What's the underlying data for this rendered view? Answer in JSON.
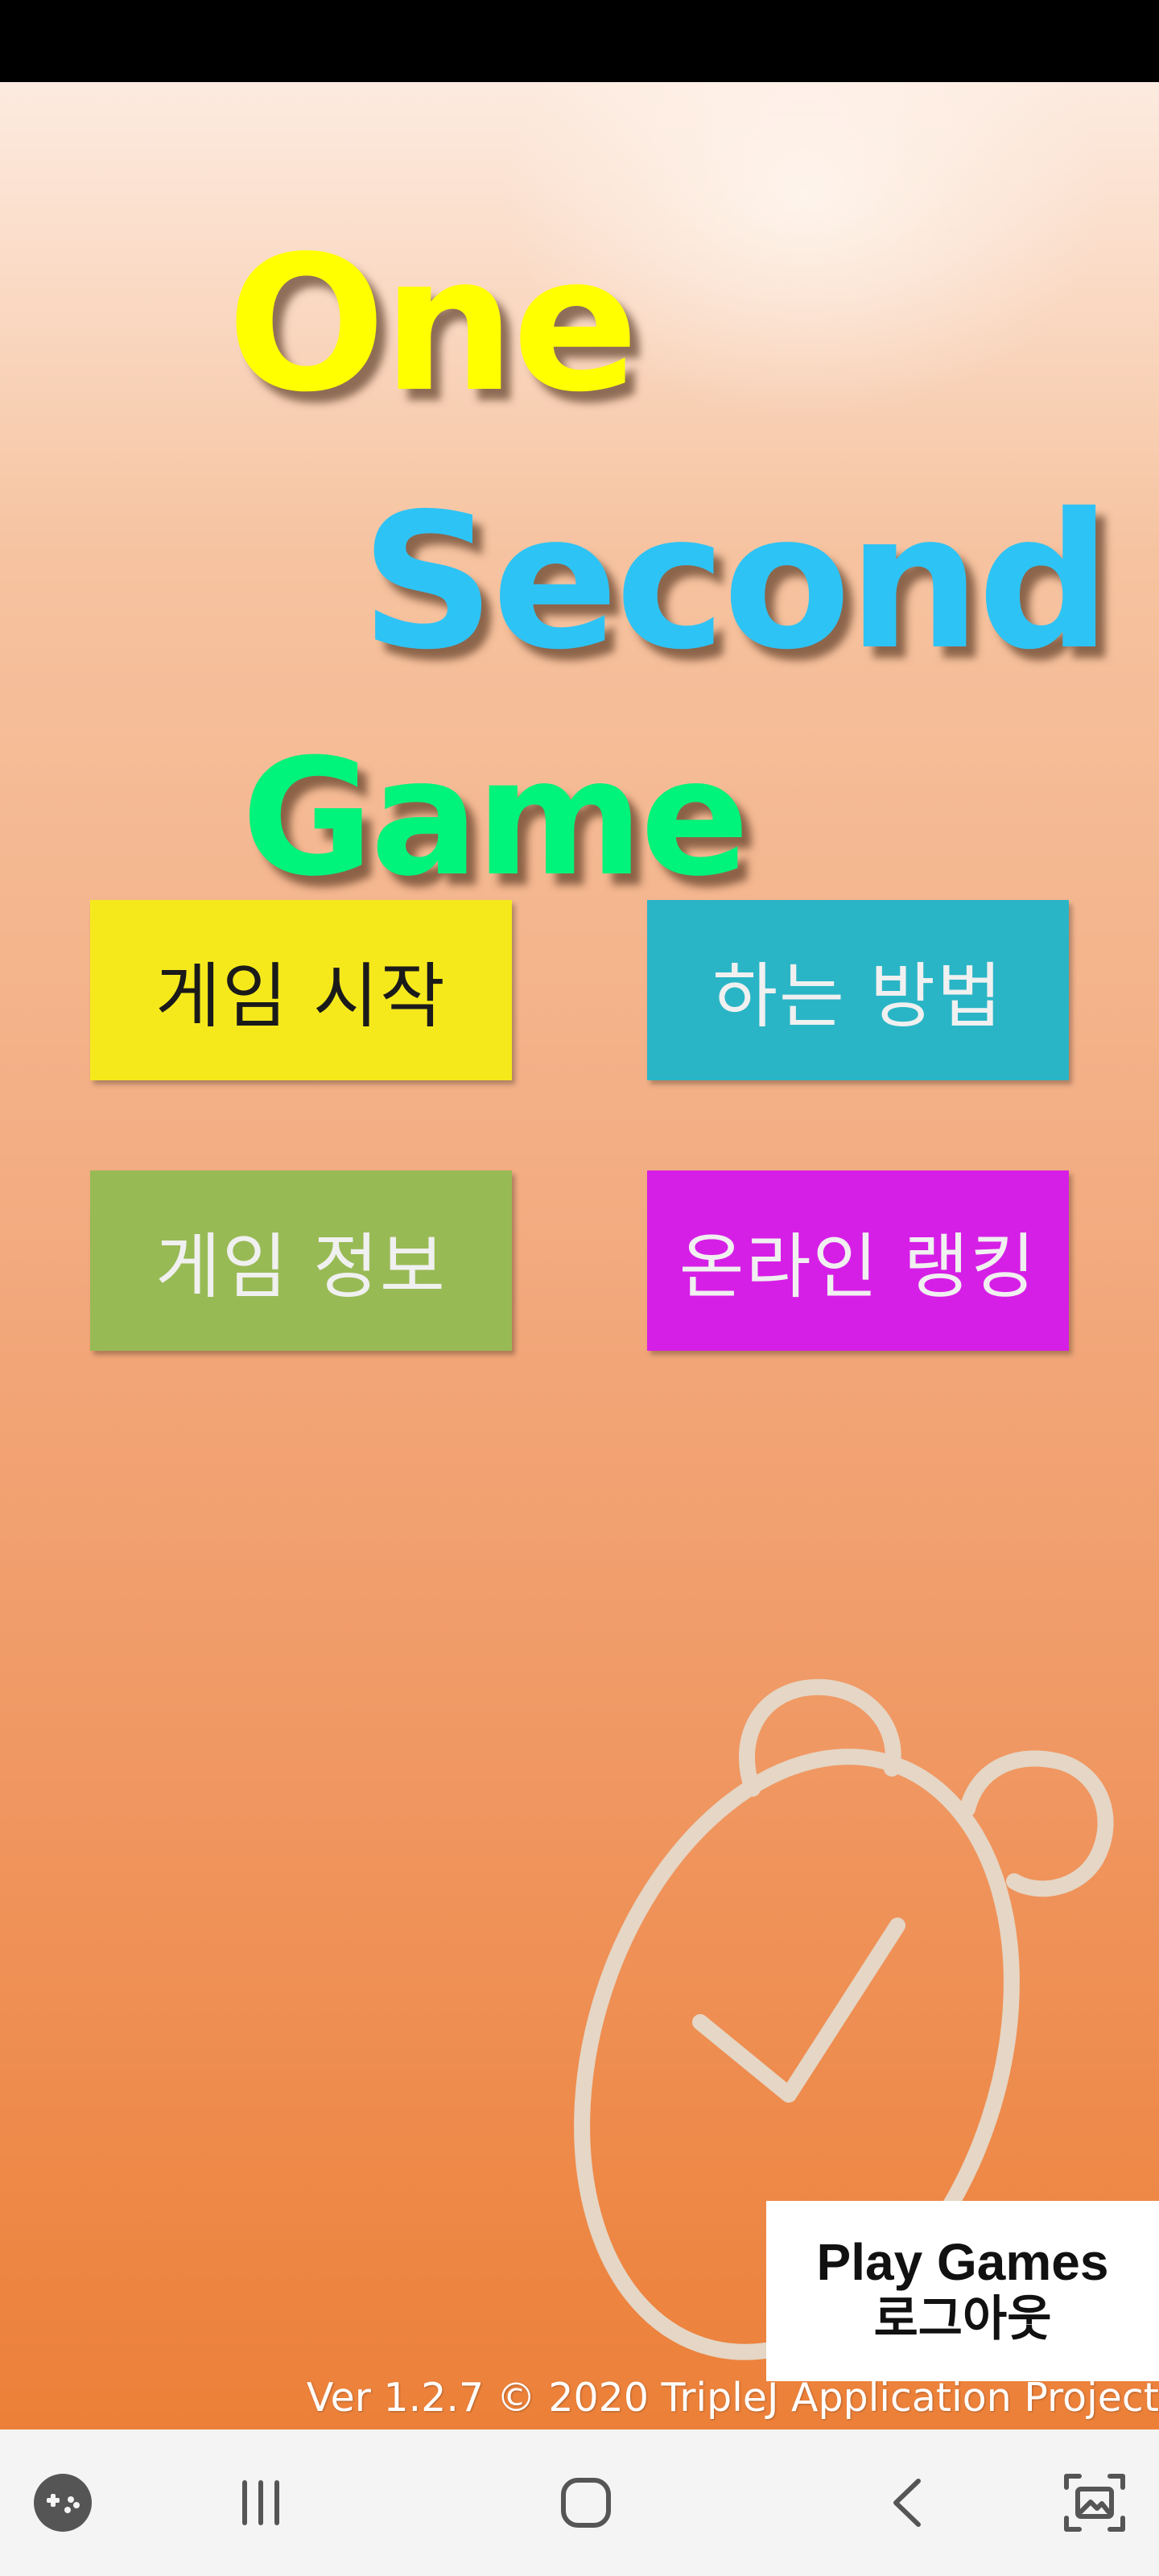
{
  "title": {
    "line1": "One",
    "line2": "Second",
    "line3": "Game"
  },
  "menu": [
    {
      "label": "게임 시작",
      "bg": "#f5e91c",
      "fg": "#1a1a1a"
    },
    {
      "label": "하는 방법",
      "bg": "#2ab5c6",
      "fg": "#f0f0f0"
    },
    {
      "label": "게임 정보",
      "bg": "#98ba55",
      "fg": "#f0f0f0"
    },
    {
      "label": "온라인 랭킹",
      "bg": "#d61fe6",
      "fg": "#f0f0f0"
    }
  ],
  "play_games": {
    "title": "Play Games",
    "subtitle": "로그아웃"
  },
  "version": "Ver 1.2.7 © 2020 TripleJ Application Project",
  "nav": {
    "icons": [
      "game-launcher-icon",
      "recent-apps-icon",
      "home-icon",
      "back-icon",
      "screenshot-icon"
    ]
  },
  "colors": {
    "background_top": "#fdebe0",
    "background_bottom": "#ec8038",
    "clock_stroke": "#e5d6c5"
  }
}
